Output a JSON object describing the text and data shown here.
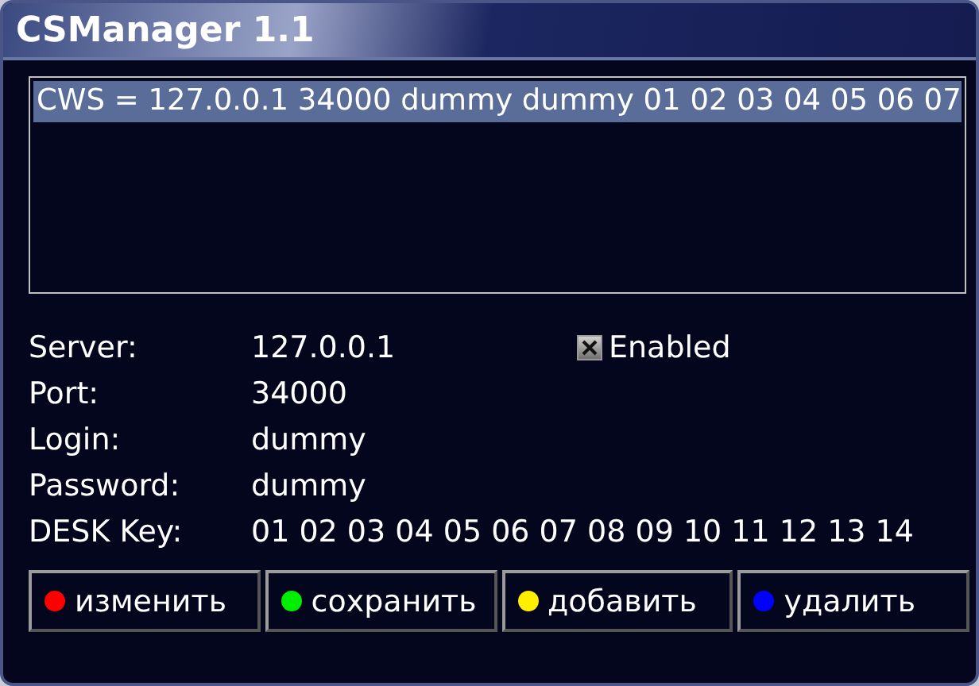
{
  "window": {
    "title": "CSManager 1.1"
  },
  "list": {
    "items": [
      {
        "text": "CWS = 127.0.0.1 34000 dummy dummy 01 02 03 04 05 06 07",
        "selected": true
      }
    ]
  },
  "fields": [
    {
      "label": "Server:",
      "value": "127.0.0.1"
    },
    {
      "label": "Port:",
      "value": "34000"
    },
    {
      "label": "Login:",
      "value": "dummy"
    },
    {
      "label": "Password:",
      "value": "dummy"
    },
    {
      "label": "DESK Key:",
      "value": "01 02 03 04 05 06 07 08 09 10 11 12 13 14"
    }
  ],
  "enabled": {
    "label": "Enabled",
    "checked": true
  },
  "buttons": [
    {
      "label": "изменить",
      "color": "#ff0000"
    },
    {
      "label": "сохранить",
      "color": "#00ee00"
    },
    {
      "label": "добавить",
      "color": "#ffee00"
    },
    {
      "label": "удалить",
      "color": "#0000ff"
    }
  ]
}
